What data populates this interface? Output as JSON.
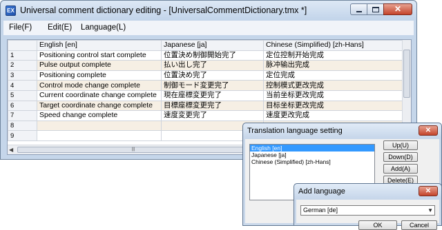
{
  "window": {
    "title": "Universal comment dictionary editing - [UniversalCommentDictionary.tmx *]",
    "app_icon": "EX"
  },
  "menu": [
    "File(F)",
    "Edit(E)",
    "Language(L)"
  ],
  "grid": {
    "columns": [
      "",
      "English [en]",
      "Japanese [ja]",
      "Chinese (Simplified) [zh-Hans]"
    ],
    "rows": [
      {
        "num": "1",
        "en": "Positioning control start complete",
        "ja": "位置決め制御開始完了",
        "zh": "定位控制开始完成"
      },
      {
        "num": "2",
        "en": "Pulse output complete",
        "ja": "払い出し完了",
        "zh": "脉冲输出完成"
      },
      {
        "num": "3",
        "en": "Positioning complete",
        "ja": "位置決め完了",
        "zh": "定位完成"
      },
      {
        "num": "4",
        "en": "Control mode change complete",
        "ja": "制御モード変更完了",
        "zh": "控制模式更改完成"
      },
      {
        "num": "5",
        "en": "Current coordinate change complete",
        "ja": "現在座標変更完了",
        "zh": "当前坐标更改完成"
      },
      {
        "num": "6",
        "en": "Target coordinate change complete",
        "ja": "目標座標変更完了",
        "zh": "目标坐标更改完成"
      },
      {
        "num": "7",
        "en": "Speed change complete",
        "ja": "速度変更完了",
        "zh": "速度更改完成"
      },
      {
        "num": "8",
        "en": "",
        "ja": "",
        "zh": ""
      },
      {
        "num": "9",
        "en": "",
        "ja": "",
        "zh": ""
      }
    ]
  },
  "translation_dialog": {
    "title": "Translation language setting",
    "languages": [
      "English [en]",
      "Japanese [ja]",
      "Chinese (Simplified) [zh-Hans]"
    ],
    "selected_index": 0,
    "buttons": {
      "up": "Up(U)",
      "down": "Down(D)",
      "add": "Add(A)",
      "delete": "Delete(E)"
    }
  },
  "add_language_dialog": {
    "title": "Add language",
    "selected_value": "German [de]",
    "ok_label": "OK",
    "cancel_label": "Cancel"
  },
  "colors": {
    "frame": "#c5d6ea",
    "alt_row": "#f6efe4",
    "selection": "#3399ff",
    "close_button": "#c4442b"
  }
}
